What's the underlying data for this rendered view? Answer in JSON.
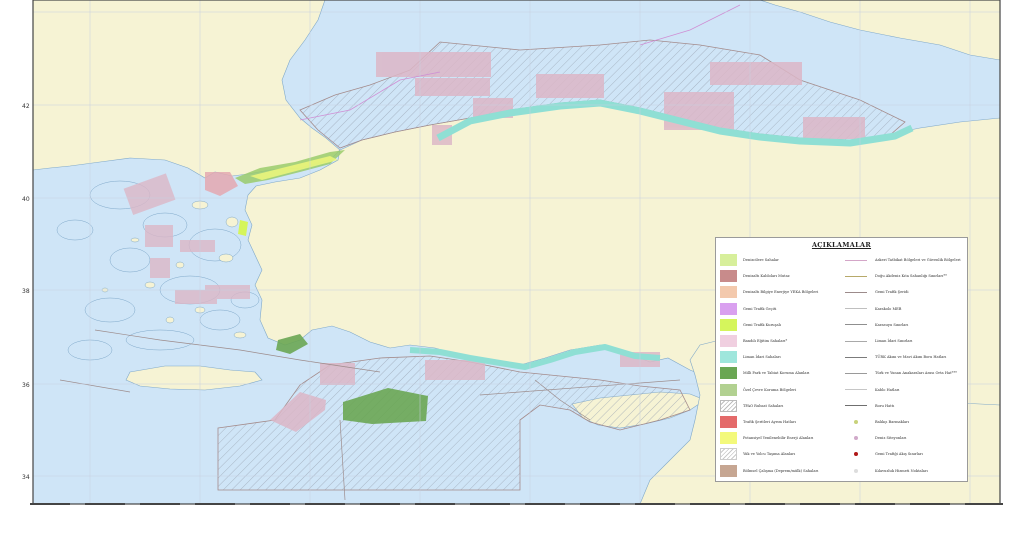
{
  "map": {
    "colors": {
      "sea": "#cfe5f7",
      "land": "#f6f3d4",
      "contour": "#7fa8c9",
      "grid": "#c7cfe0",
      "hatch": "#9aa4b2",
      "pink_zone": "#dcb7c7",
      "turquoise": "#8fdfd4",
      "frame": "#444444"
    },
    "latitude_labels": [
      "42",
      "40",
      "38",
      "36",
      "34"
    ]
  },
  "legend": {
    "title": "AÇIKLAMALAR",
    "left_items": [
      {
        "label": "Denizcilere Sahalar",
        "color": "#d7ef9b"
      },
      {
        "label": "Denizaltı Kabloları Mutaz",
        "color": "#c88b8b"
      },
      {
        "label": "Denizaltı Bilgiye Enerjiye YEKA Bölgeleri",
        "color": "#f3c9ad"
      },
      {
        "label": "Gemi Trafik Geçiti",
        "color": "#d9a0ef"
      },
      {
        "label": "Gemi Trafik Kuruşalı",
        "color": "#d5f55c"
      },
      {
        "label": "Bandılı Eğitim Sahaları*",
        "color": "#f0cfe0"
      },
      {
        "label": "Liman İdari Sahaları",
        "color": "#9fe6dc"
      },
      {
        "label": "Milli Park ve Tabiat Koruma Alanları",
        "color": "#6aa653"
      },
      {
        "label": "Özel Çevre Koruma Bölgeleri",
        "color": "#b2d191"
      },
      {
        "label": "TPAO Ruhsat Sahaları",
        "color": "hatch"
      },
      {
        "label": "Trafik Şeritleri Ayrım Hatları",
        "color": "#e46a6a"
      },
      {
        "label": "Potansiyel Yenilenebilir Enerji Alanları",
        "color": "#f3f97b"
      },
      {
        "label": "Yük ve Yolcu Taşıma Alanları",
        "color": "hatch2"
      },
      {
        "label": "Bölmsel Çalışma (Deprem/mülk) Sahaları",
        "color": "#c6a692"
      }
    ],
    "right_items": [
      {
        "label": "Askeri Tatbikat Bölgeleri ve Güvenlik Bölgeleri",
        "kind": "line",
        "color": "#d4a6c8"
      },
      {
        "label": "Doğu Akdeniz Kıta Sahanlığı Sınırları**",
        "kind": "line",
        "color": "#b7a96a"
      },
      {
        "label": "Gemi Trafik Şeridi",
        "kind": "line",
        "color": "#9c8b8b"
      },
      {
        "label": "Karakolo MEB",
        "kind": "line",
        "color": "#bfbfbf"
      },
      {
        "label": "Karasuyu Sınırları",
        "kind": "line",
        "color": "#8f8f8f"
      },
      {
        "label": "Liman İdari Sınırları",
        "kind": "line",
        "color": "#a9a9a9"
      },
      {
        "label": "TÜRK Akını ve Mavi Akım Boru Hatları",
        "kind": "line",
        "color": "#7b7b7b"
      },
      {
        "label": "Türk ve Yunan Anakaraları Arası Orta Hat***",
        "kind": "line",
        "color": "#9a9a9a"
      },
      {
        "label": "Kablo Hatları",
        "kind": "line",
        "color": "#c6c6c6"
      },
      {
        "label": "Boru Hattı",
        "kind": "line",
        "color": "#6f6f6f"
      },
      {
        "label": "Balıkçı Barınakları",
        "kind": "dot",
        "color": "#c8d27a"
      },
      {
        "label": "Deniz Siteyonları",
        "kind": "dot",
        "color": "#d0a9c9"
      },
      {
        "label": "Gemi Trafiği Akış Sınırları",
        "kind": "dot",
        "color": "#b01818"
      },
      {
        "label": "Kılavuzluk Hizmeti Noktaları",
        "kind": "dot",
        "color": "#dddddd"
      }
    ]
  }
}
